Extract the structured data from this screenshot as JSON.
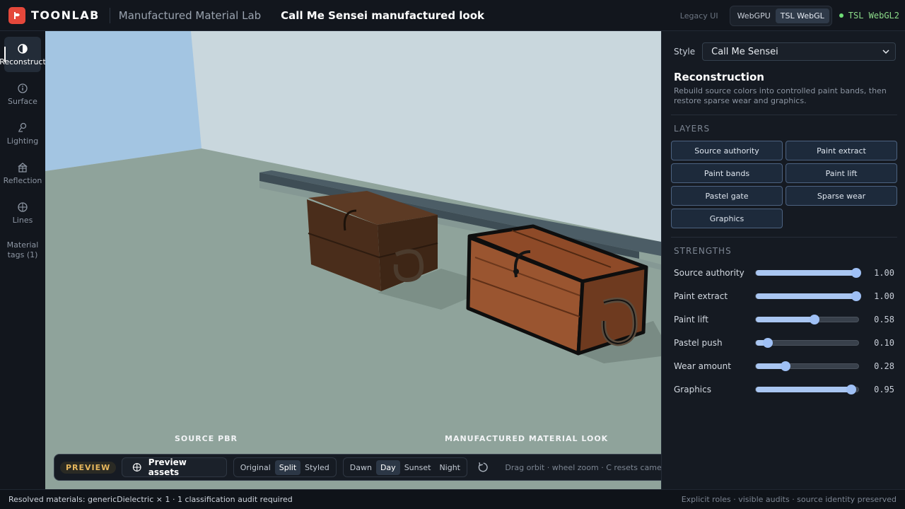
{
  "header": {
    "brand": "TOONLAB",
    "app_title": "Manufactured Material Lab",
    "look_title": "Call Me Sensei manufactured look",
    "legacy_link": "Legacy UI",
    "renderers": [
      {
        "label": "WebGPU",
        "active": false
      },
      {
        "label": "TSL WebGL",
        "active": true
      }
    ],
    "status": "TSL WebGL2"
  },
  "rail": {
    "items": [
      {
        "label": "Reconstruct",
        "icon": "half-circle-icon",
        "active": true
      },
      {
        "label": "Surface",
        "icon": "info-circle-icon",
        "active": false
      },
      {
        "label": "Lighting",
        "icon": "lamp-icon",
        "active": false
      },
      {
        "label": "Reflection",
        "icon": "chest-icon",
        "active": false
      },
      {
        "label": "Lines",
        "icon": "crosshair-circle-icon",
        "active": false
      }
    ],
    "material_tags": "Material tags (1)"
  },
  "viewport": {
    "left_label": "SOURCE PBR",
    "right_label": "MANUFACTURED MATERIAL LOOK"
  },
  "toolbar": {
    "badge": "PREVIEW",
    "assets_button": "Preview assets",
    "view_modes": [
      {
        "label": "Original",
        "active": false
      },
      {
        "label": "Split",
        "active": true
      },
      {
        "label": "Styled",
        "active": false
      }
    ],
    "times": [
      {
        "label": "Dawn",
        "active": false
      },
      {
        "label": "Day",
        "active": true
      },
      {
        "label": "Sunset",
        "active": false
      },
      {
        "label": "Night",
        "active": false
      }
    ],
    "hint": "Drag orbit · wheel zoom · C resets camera"
  },
  "panel": {
    "style_label": "Style",
    "style_value": "Call Me Sensei",
    "section_title": "Reconstruction",
    "section_desc": "Rebuild source colors into controlled paint bands, then restore sparse wear and graphics.",
    "layers_title": "LAYERS",
    "layers": [
      "Source authority",
      "Paint extract",
      "Paint bands",
      "Paint lift",
      "Pastel gate",
      "Sparse wear",
      "Graphics"
    ],
    "strengths_title": "STRENGTHS",
    "strengths": [
      {
        "label": "Source authority",
        "value": 1.0,
        "display": "1.00"
      },
      {
        "label": "Paint extract",
        "value": 1.0,
        "display": "1.00"
      },
      {
        "label": "Paint lift",
        "value": 0.58,
        "display": "0.58"
      },
      {
        "label": "Pastel push",
        "value": 0.1,
        "display": "0.10"
      },
      {
        "label": "Wear amount",
        "value": 0.28,
        "display": "0.28"
      },
      {
        "label": "Graphics",
        "value": 0.95,
        "display": "0.95"
      }
    ]
  },
  "statusbar": {
    "left": "Resolved materials: genericDielectric × 1 · 1 classification audit required",
    "right": "Explicit roles · visible audits · source identity preserved"
  },
  "colors": {
    "accent": "#a9c6f2",
    "brand": "#e5483b",
    "status_ok": "#6fdc76",
    "preview_badge": "#e6b65c"
  }
}
